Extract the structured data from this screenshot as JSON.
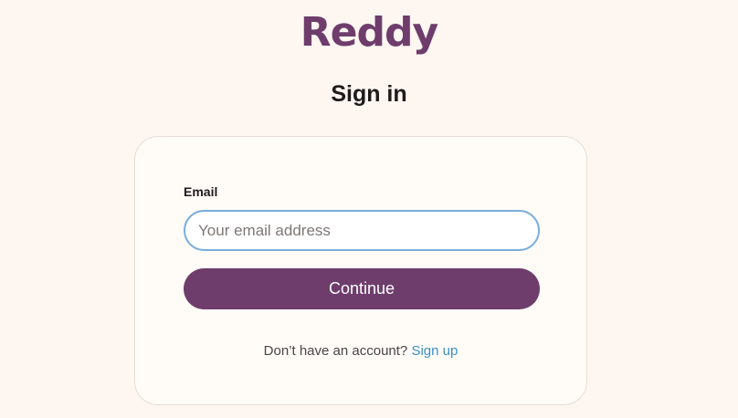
{
  "brand": {
    "logo_text": "Reddy",
    "color": "#6e3d6c"
  },
  "page": {
    "title": "Sign in"
  },
  "form": {
    "email_label": "Email",
    "email_value": "",
    "email_placeholder": "Your email address",
    "continue_label": "Continue"
  },
  "footer": {
    "prompt_text": "Don’t have an account?",
    "signup_link_label": "Sign up"
  },
  "colors": {
    "background": "#fdf6f1",
    "accent": "#6e3d6c",
    "input_focus_border": "#79aedc",
    "link": "#3a8fc4"
  }
}
